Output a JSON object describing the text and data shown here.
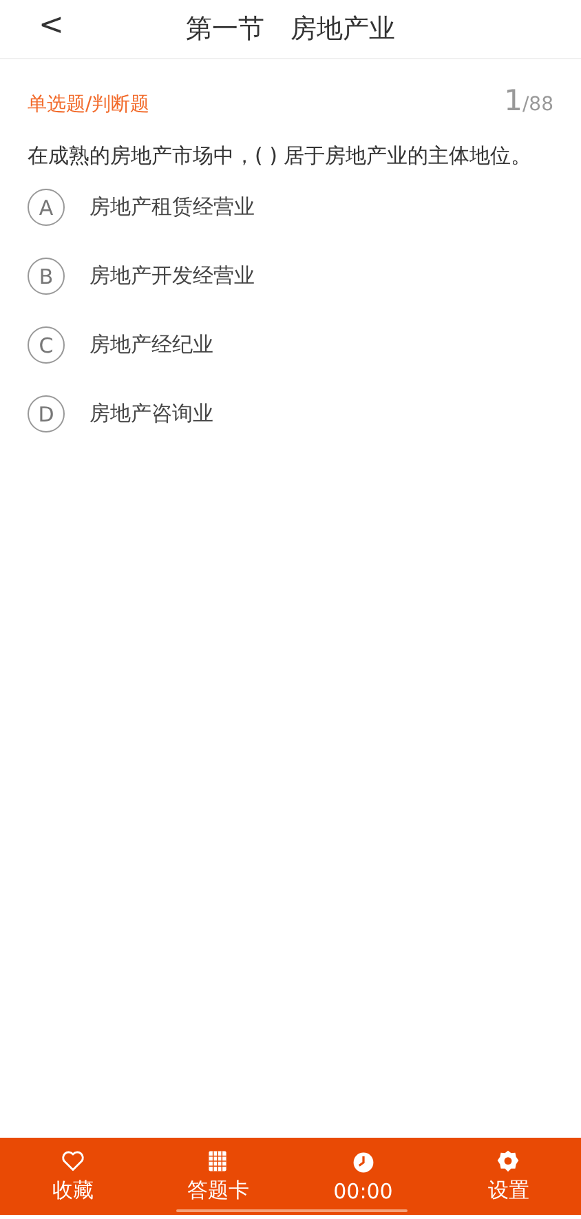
{
  "header": {
    "back": "<",
    "title": "第一节　房地产业"
  },
  "question": {
    "type": "单选题/判断题",
    "current": "1",
    "total": "/88",
    "text": "在成熟的房地产市场中，( ) 居于房地产业的主体地位。"
  },
  "options": [
    {
      "letter": "A",
      "text": "房地产租赁经营业",
      "selected": false
    },
    {
      "letter": "B",
      "text": "房地产开发经营业",
      "selected": false
    },
    {
      "letter": "C",
      "text": "房地产经纪业",
      "selected": false
    },
    {
      "letter": "D",
      "text": "房地产咨询业",
      "selected": false
    }
  ],
  "bottom_bar": [
    {
      "label": "收藏"
    },
    {
      "label": "答题卡"
    },
    {
      "label": "00:00"
    },
    {
      "label": "设置"
    }
  ]
}
